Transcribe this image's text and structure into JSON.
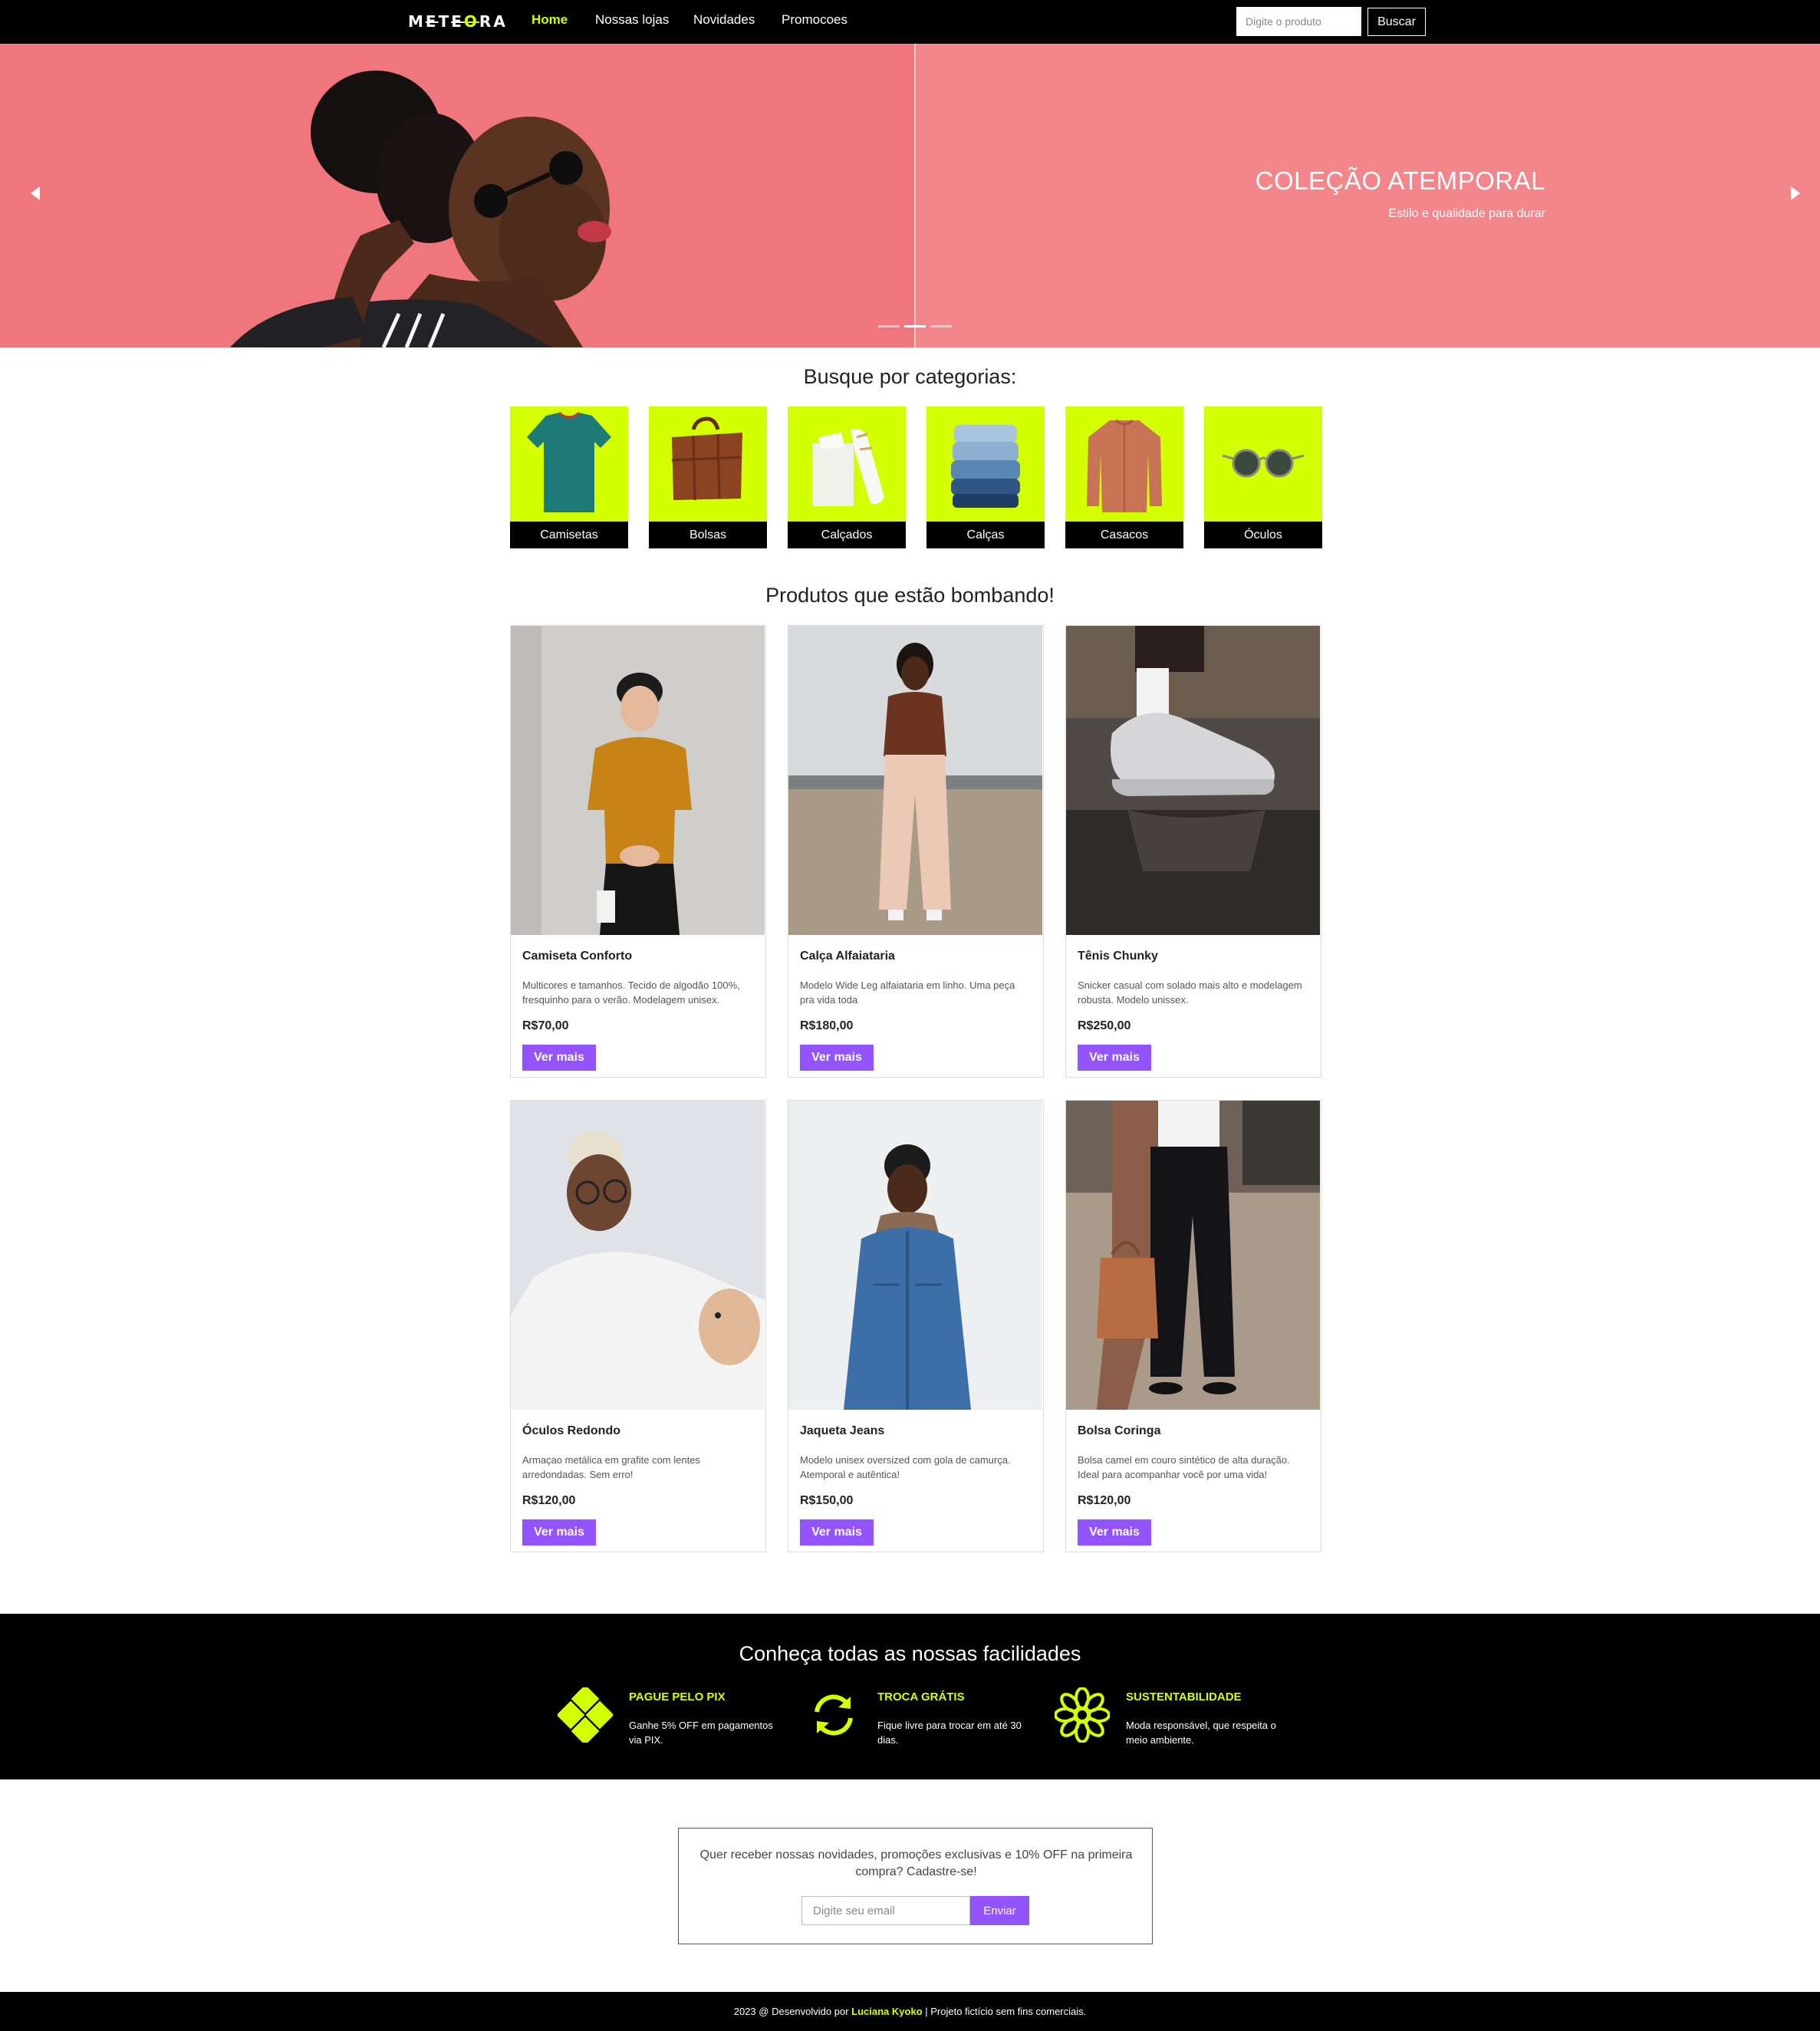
{
  "navbar": {
    "logo": "METEORA",
    "links": [
      "Home",
      "Nossas lojas",
      "Novidades",
      "Promocoes"
    ],
    "search_placeholder": "Digite o produto",
    "search_button": "Buscar"
  },
  "hero": {
    "title": "COLEÇÃO ATEMPORAL",
    "subtitle": "Estilo e qualidade para durar",
    "slide_count": 3,
    "active_slide": 2
  },
  "categories": {
    "title": "Busque por categorias:",
    "items": [
      "Camisetas",
      "Bolsas",
      "Calçados",
      "Calças",
      "Casacos",
      "Óculos"
    ]
  },
  "products": {
    "title": "Produtos que estão bombando!",
    "button_label": "Ver mais",
    "items": [
      {
        "name": "Camiseta Conforto",
        "description": "Multicores e tamanhos. Tecido de algodão 100%, fresquinho para o verão. Modelagem unisex.",
        "price": "R$70,00"
      },
      {
        "name": "Calça Alfaiataria",
        "description": "Modelo Wide Leg alfaiataria em linho. Uma peça pra vida toda",
        "price": "R$180,00"
      },
      {
        "name": "Tênis Chunky",
        "description": "Snicker casual com solado mais alto e modelagem robusta. Modelo unissex.",
        "price": "R$250,00"
      },
      {
        "name": "Óculos Redondo",
        "description": "Armaçao metálica em grafite com lentes arredondadas. Sem erro!",
        "price": "R$120,00"
      },
      {
        "name": "Jaqueta Jeans",
        "description": "Modelo unisex oversized com gola de camurça. Atemporal e autêntica!",
        "price": "R$150,00"
      },
      {
        "name": "Bolsa Coringa",
        "description": "Bolsa camel em couro sintético de alta duração. Ideal para acompanhar você por uma vida!",
        "price": "R$120,00"
      }
    ]
  },
  "facilities": {
    "title": "Conheça todas as nossas facilidades",
    "items": [
      {
        "icon": "pix-icon",
        "heading": "PAGUE PELO PIX",
        "text": "Ganhe 5% OFF em pagamentos via PIX."
      },
      {
        "icon": "exchange-icon",
        "heading": "TROCA GRÁTIS",
        "text": "Fique livre para trocar em até 30 dias."
      },
      {
        "icon": "flower-icon",
        "heading": "SUSTENTABILIDADE",
        "text": "Moda responsável, que respeita o meio ambiente."
      }
    ]
  },
  "newsletter": {
    "text": "Quer receber nossas novidades, promoções exclusivas e 10% OFF na primeira compra? Cadastre-se!",
    "placeholder": "Digite seu email",
    "button": "Enviar"
  },
  "footer": {
    "prefix": "2023 @ Desenvolvido por",
    "author": "Luciana Kyoko",
    "suffix": "| Projeto fictício sem fins comerciais."
  },
  "colors": {
    "accent": "#d4ff00",
    "button": "#9353ff",
    "hero": "#f3868b",
    "dark": "#000000"
  }
}
